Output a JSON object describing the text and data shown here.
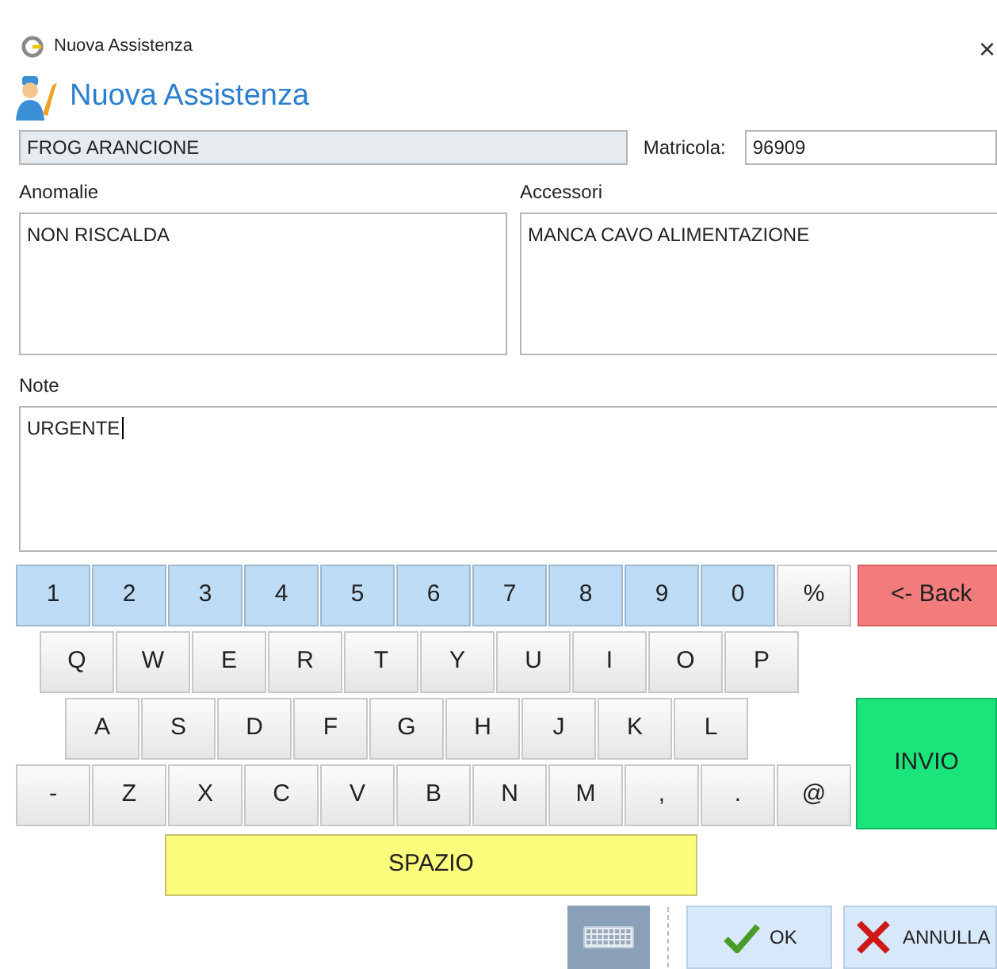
{
  "window": {
    "title": "Nuova Assistenza",
    "close": "×"
  },
  "header": {
    "title": "Nuova Assistenza"
  },
  "product": {
    "value": "FROG ARANCIONE"
  },
  "matricola": {
    "label": "Matricola:",
    "value": "96909"
  },
  "anomalie": {
    "label": "Anomalie",
    "value": "NON RISCALDA"
  },
  "accessori": {
    "label": "Accessori",
    "value": "MANCA CAVO ALIMENTAZIONE"
  },
  "note": {
    "label": "Note",
    "value": "URGENTE"
  },
  "keyboard": {
    "rows": [
      [
        {
          "label": "1",
          "kind": "digit"
        },
        {
          "label": "2",
          "kind": "digit"
        },
        {
          "label": "3",
          "kind": "digit"
        },
        {
          "label": "4",
          "kind": "digit"
        },
        {
          "label": "5",
          "kind": "digit"
        },
        {
          "label": "6",
          "kind": "digit"
        },
        {
          "label": "7",
          "kind": "digit"
        },
        {
          "label": "8",
          "kind": "digit"
        },
        {
          "label": "9",
          "kind": "digit"
        },
        {
          "label": "0",
          "kind": "digit"
        },
        {
          "label": "%",
          "kind": "letter"
        },
        {
          "label": "<- Back",
          "kind": "back"
        }
      ],
      [
        {
          "label": "Q",
          "kind": "letter"
        },
        {
          "label": "W",
          "kind": "letter"
        },
        {
          "label": "E",
          "kind": "letter"
        },
        {
          "label": "R",
          "kind": "letter"
        },
        {
          "label": "T",
          "kind": "letter"
        },
        {
          "label": "Y",
          "kind": "letter"
        },
        {
          "label": "U",
          "kind": "letter"
        },
        {
          "label": "I",
          "kind": "letter"
        },
        {
          "label": "O",
          "kind": "letter"
        },
        {
          "label": "P",
          "kind": "letter"
        }
      ],
      [
        {
          "label": "A",
          "kind": "letter"
        },
        {
          "label": "S",
          "kind": "letter"
        },
        {
          "label": "D",
          "kind": "letter"
        },
        {
          "label": "F",
          "kind": "letter"
        },
        {
          "label": "G",
          "kind": "letter"
        },
        {
          "label": "H",
          "kind": "letter"
        },
        {
          "label": "J",
          "kind": "letter"
        },
        {
          "label": "K",
          "kind": "letter"
        },
        {
          "label": "L",
          "kind": "letter"
        }
      ],
      [
        {
          "label": "-",
          "kind": "letter"
        },
        {
          "label": "Z",
          "kind": "letter"
        },
        {
          "label": "X",
          "kind": "letter"
        },
        {
          "label": "C",
          "kind": "letter"
        },
        {
          "label": "V",
          "kind": "letter"
        },
        {
          "label": "B",
          "kind": "letter"
        },
        {
          "label": "N",
          "kind": "letter"
        },
        {
          "label": "M",
          "kind": "letter"
        },
        {
          "label": ",",
          "kind": "letter"
        },
        {
          "label": ".",
          "kind": "letter"
        },
        {
          "label": "@",
          "kind": "letter"
        }
      ]
    ],
    "enter": "INVIO",
    "space": "SPAZIO"
  },
  "buttons": [
    {
      "label": "OK",
      "kind": "ok"
    },
    {
      "label": "ANNULLA",
      "kind": "cancel"
    }
  ]
}
